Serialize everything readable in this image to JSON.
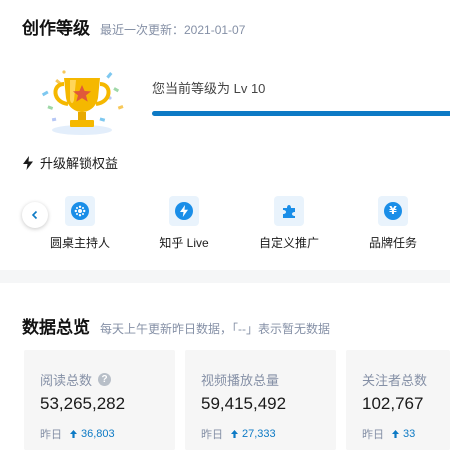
{
  "level_card": {
    "title": "创作等级",
    "last_updated": "最近一次更新：2021-01-07",
    "level_text": "您当前等级为 Lv 10",
    "progress": 1.0,
    "unlock_label": "升级解锁权益",
    "benefits": [
      {
        "label": "圆桌主持人",
        "icon": "roundtable-icon"
      },
      {
        "label": "知乎 Live",
        "icon": "lightning-icon"
      },
      {
        "label": "自定义推广",
        "icon": "puzzle-icon"
      },
      {
        "label": "品牌任务",
        "icon": "yuan-badge-icon"
      }
    ]
  },
  "data_card": {
    "title": "数据总览",
    "subtitle": "每天上午更新昨日数据，「--」表示暂无数据",
    "stats": [
      {
        "label": "阅读总数",
        "value": "53,265,282",
        "yesterday_label": "昨日",
        "yesterday_delta": "36,803",
        "has_help": true
      },
      {
        "label": "视频播放总量",
        "value": "59,415,492",
        "yesterday_label": "昨日",
        "yesterday_delta": "27,333",
        "has_help": false
      },
      {
        "label": "关注者总数",
        "value": "102,767",
        "yesterday_label": "昨日",
        "yesterday_delta": "33",
        "has_help": false
      }
    ]
  },
  "colors": {
    "accent": "#0d7ac5",
    "icon_bg": "#e9f3fc",
    "icon_fg": "#1a8ee8",
    "muted": "#8590a6",
    "trophy_gold": "#f5b800"
  }
}
